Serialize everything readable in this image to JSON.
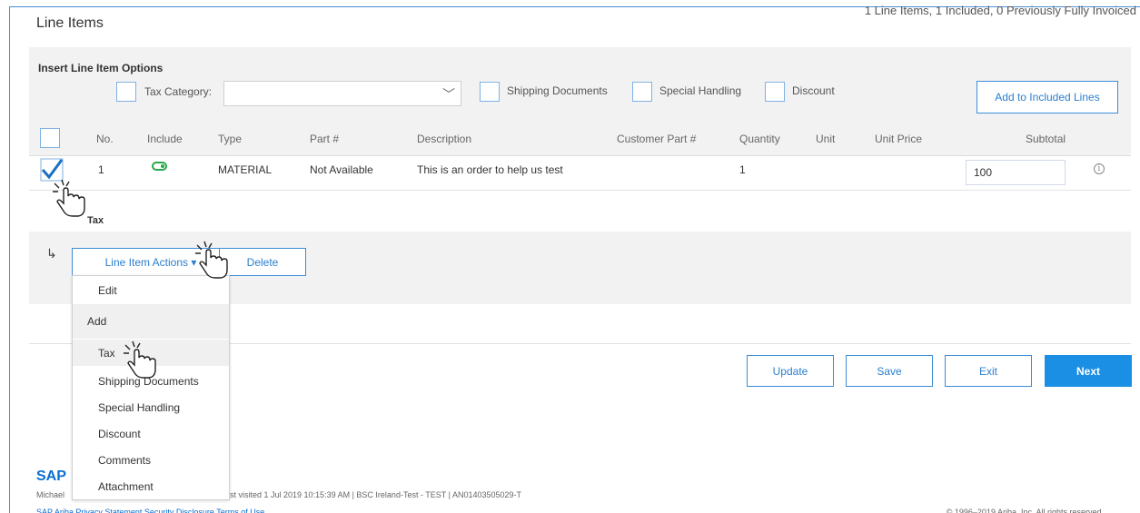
{
  "header": {
    "title": "Line Items",
    "summary": "1 Line Items, 1 Included, 0 Previously Fully Invoiced"
  },
  "options": {
    "title": "Insert Line Item Options",
    "tax_category_label": "Tax Category:",
    "tax_category_value": "",
    "shipping_documents_label": "Shipping Documents",
    "special_handling_label": "Special Handling",
    "discount_label": "Discount",
    "add_button_label": "Add to Included Lines"
  },
  "table": {
    "columns": [
      "No.",
      "Include",
      "Type",
      "Part #",
      "Description",
      "Customer Part #",
      "Quantity",
      "Unit",
      "Unit Price",
      "Subtotal"
    ],
    "rows": [
      {
        "no": "1",
        "include": true,
        "type": "MATERIAL",
        "part": "Not Available",
        "description": "This is an order to help us test",
        "customer_part": "",
        "quantity": "1",
        "unit": "",
        "unit_price": "",
        "subtotal": "100",
        "checked": true
      }
    ],
    "sub_label": "Tax"
  },
  "actions": {
    "line_item_actions_label": "Line Item Actions ▾",
    "delete_label": "Delete",
    "menu": {
      "edit": "Edit",
      "add_header": "Add",
      "items": [
        "Tax",
        "Shipping Documents",
        "Special Handling",
        "Discount",
        "Comments",
        "Attachment"
      ]
    }
  },
  "buttons": {
    "update": "Update",
    "save": "Save",
    "exit": "Exit",
    "next": "Next"
  },
  "footer": {
    "logo": "SAP",
    "meta_prefix": "Michael",
    "meta_suffix": "st visited 1 Jul 2019 10:15:39 AM | BSC Ireland-Test - TEST | AN01403505029-T",
    "links": "SAP Ariba Privacy Statement     Security Disclosure     Terms of Use",
    "copyright": "© 1996–2019 Ariba, Inc. All rights reserved."
  },
  "colors": {
    "accent": "#1b8fe3",
    "outline": "#3c8dd8",
    "toggle_on": "#27a84a",
    "panel": "#f2f2f2"
  }
}
